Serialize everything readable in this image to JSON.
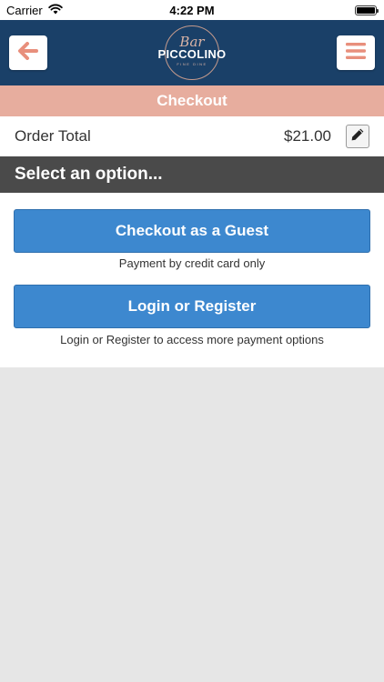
{
  "status_bar": {
    "carrier": "Carrier",
    "time": "4:22 PM",
    "battery_level": 1.0
  },
  "header": {
    "logo": {
      "script": "Bar",
      "name": "PICCOLINO",
      "tagline": "FINE DINE"
    },
    "accent_color": "#e88f7c",
    "background_color": "#1a4068"
  },
  "banner": {
    "title": "Checkout",
    "color": "#e7ad9e"
  },
  "order": {
    "label": "Order Total",
    "value": "$21.00"
  },
  "select_header": "Select an option...",
  "options": {
    "guest": {
      "label": "Checkout as a Guest",
      "note": "Payment by credit card only"
    },
    "login": {
      "label": "Login or Register",
      "note": "Login or Register to access more payment options"
    },
    "button_color": "#3d88cf"
  },
  "icons": [
    "wifi-icon",
    "battery-icon",
    "back-arrow-icon",
    "hamburger-menu-icon",
    "pencil-icon"
  ]
}
